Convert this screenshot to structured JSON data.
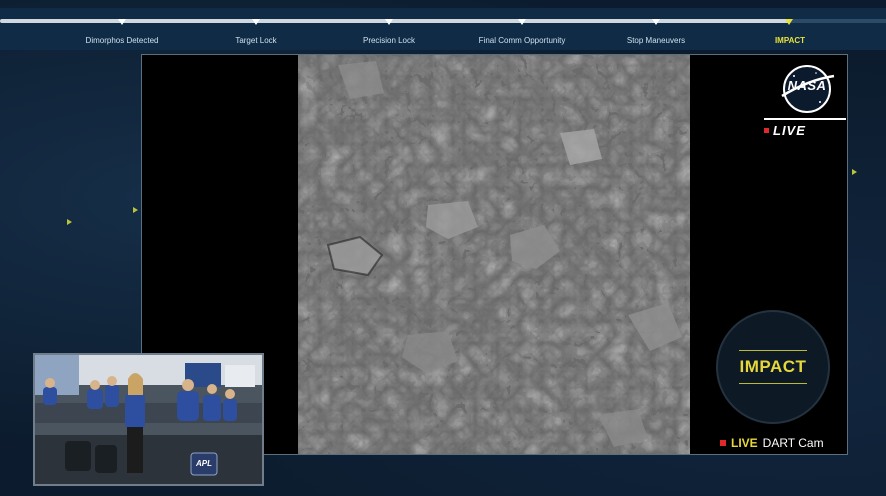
{
  "timeline": {
    "steps": [
      {
        "label": "Dimorphos Detected",
        "active": false
      },
      {
        "label": "Target Lock",
        "active": false
      },
      {
        "label": "Precision Lock",
        "active": false
      },
      {
        "label": "Final Comm Opportunity",
        "active": false
      },
      {
        "label": "Stop Maneuvers",
        "active": false
      },
      {
        "label": "IMPACT",
        "active": true
      }
    ]
  },
  "broadcast": {
    "logo_text": "NASA",
    "live_label": "LIVE",
    "impact_label": "IMPACT",
    "cam_live": "LIVE",
    "cam_name": "DART Cam"
  },
  "pip": {
    "badge_text": "APL"
  },
  "colors": {
    "accent_yellow": "#e6d83a",
    "live_red": "#e02a2a",
    "panel_blue": "#0f2b45"
  }
}
